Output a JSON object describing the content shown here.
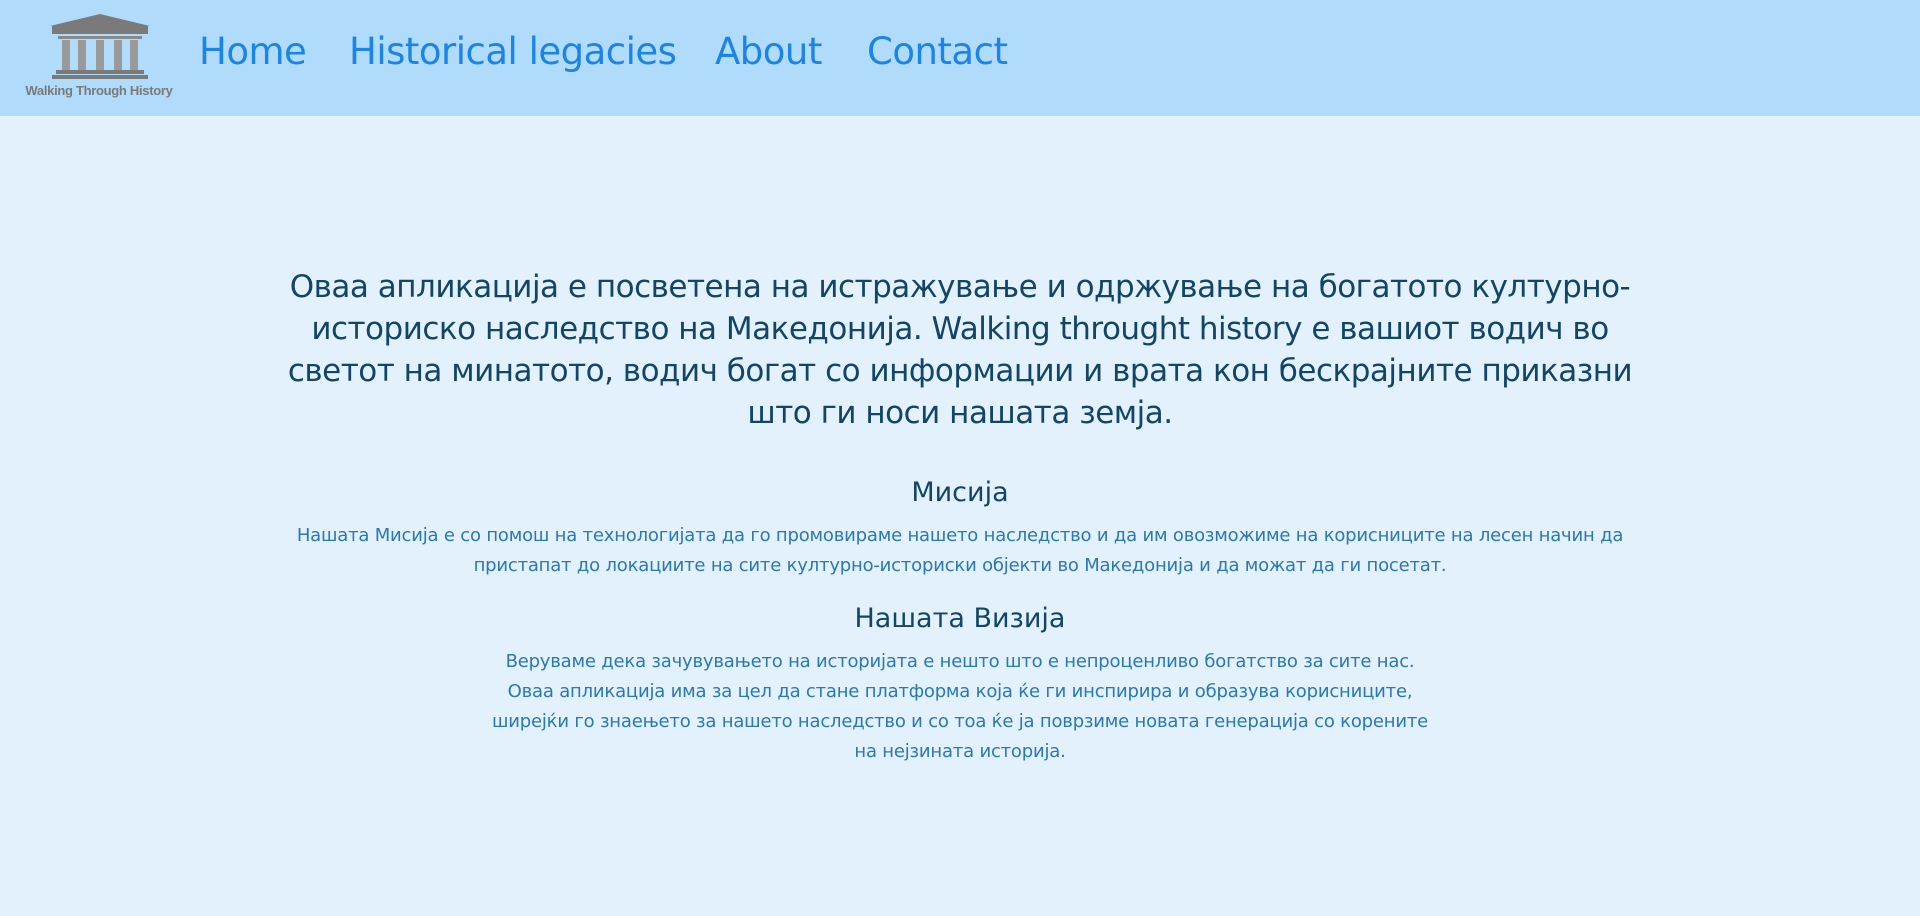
{
  "header": {
    "logo_text": "Walking Through History",
    "logo_icon": "pantheon-columns-icon",
    "nav": [
      {
        "label": "Home"
      },
      {
        "label": "Historical legacies"
      },
      {
        "label": "About"
      },
      {
        "label": "Contact"
      }
    ]
  },
  "main": {
    "intro_lines": [
      "Оваа апликација е посветена на истражување и одржување на богатото културно-",
      "историско наследство на Македонија. Walking throught history е вашиот водич во",
      "светот на минатото, водич богат со информации и врата кон бескрајните приказни",
      "што ги носи нашата земја."
    ],
    "mission": {
      "title": "Мисија",
      "lines": [
        "Нашата Мисија е со помош на технологијата да го промовираме нашето наследство и да им овозможиме на корисниците на лесен начин да",
        "пристапат до локациите на сите културно-историски објекти во Македонија и да можат да ги посетат."
      ]
    },
    "vision": {
      "title": "Нашата Визија",
      "lines": [
        "Веруваме дека зачувувањето на историјата е нешто што е непроценливо богатство за сите нас.",
        "Оваа апликација има за цел да стане платформа која ќе ги инспирира и образува корисниците,",
        "ширејќи го знаењето за нашето наследство и со тоа ќе ја поврзиме новата генерација со корените",
        "на нејзината историја."
      ]
    }
  },
  "colors": {
    "header_bg": "#b1dbfa",
    "page_bg": "#e2f1fc",
    "nav_link": "#1a84e8",
    "heading": "#124566",
    "body_text": "#2a78b5"
  }
}
